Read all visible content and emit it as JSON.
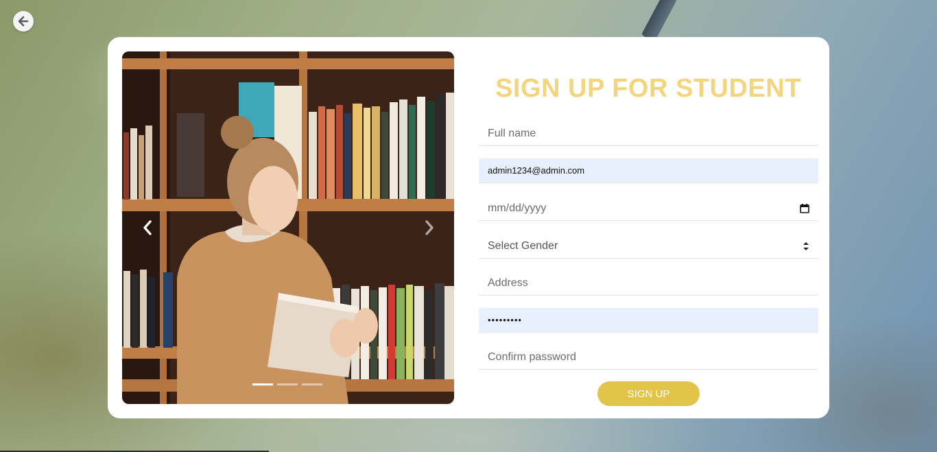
{
  "form": {
    "title": "SIGN UP FOR STUDENT",
    "full_name_placeholder": "Full name",
    "email_value": "admin1234@admin.com",
    "dob_placeholder": "mm/dd/yyyy",
    "gender_selected": "Select Gender",
    "address_placeholder": "Address",
    "password_value": "•••••••••",
    "confirm_password_placeholder": "Confirm password",
    "submit_label": "SIGN UP"
  },
  "carousel": {
    "slide_count": 3,
    "active_index": 0,
    "prev_icon": "chevron-left-icon",
    "next_icon": "chevron-right-icon"
  },
  "nav": {
    "back_icon": "arrow-left-icon"
  },
  "colors": {
    "title": "#f3d57e",
    "button": "#e3c44a",
    "autofill": "#e8f0fe"
  }
}
